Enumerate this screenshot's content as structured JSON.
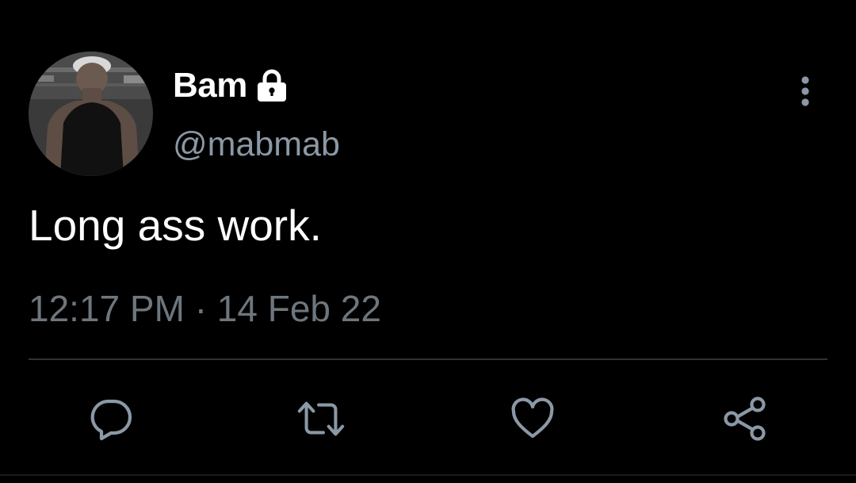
{
  "tweet": {
    "display_name": "Bam",
    "handle": "@mabmab",
    "protected": true,
    "text": "Long ass work.",
    "time": "12:17 PM",
    "separator": "·",
    "date": "14 Feb 22"
  },
  "icons": {
    "lock": "lock-icon",
    "more": "more-vertical-icon",
    "reply": "reply-icon",
    "retweet": "retweet-icon",
    "like": "heart-icon",
    "share": "share-icon"
  },
  "colors": {
    "background": "#000000",
    "primary_text": "#ffffff",
    "secondary_text": "#8b98a5",
    "timestamp_text": "#6e767d",
    "icon": "#8b98a5",
    "divider": "#2f3336"
  }
}
